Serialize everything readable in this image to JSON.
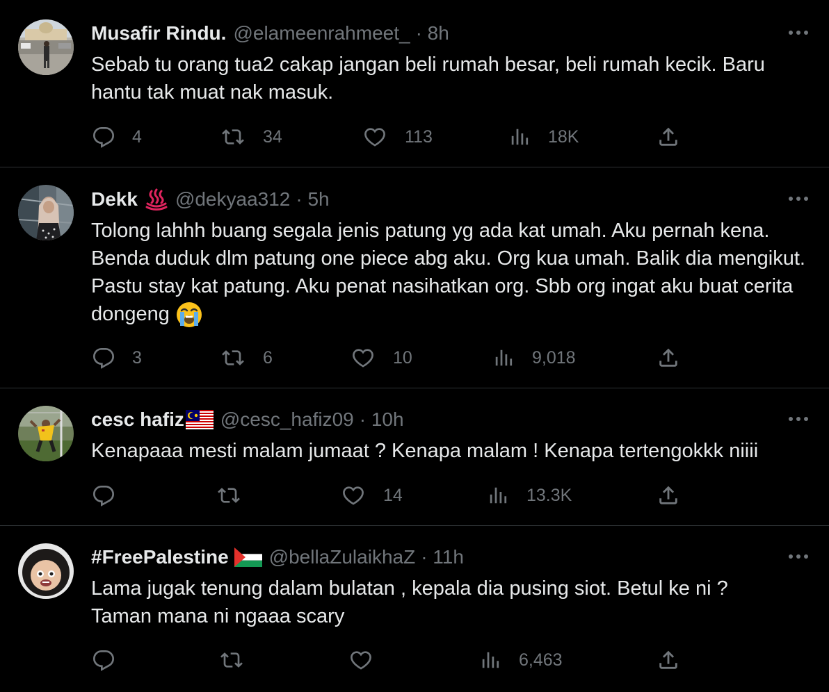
{
  "tweets": [
    {
      "display_name": "Musafir Rindu.",
      "handle": "@elameenrahmeet_",
      "time": "· 8h",
      "text": "Sebab tu orang tua2 cakap jangan beli rumah besar, beli rumah kecik. Baru hantu tak muat nak masuk.",
      "replies": "4",
      "retweets": "34",
      "likes": "113",
      "views": "18K"
    },
    {
      "display_name": "Dekk",
      "name_icon": "hot-springs-emoji",
      "handle": "@dekyaa312",
      "time": "· 5h",
      "text": "Tolong lahhh buang segala jenis patung yg ada kat umah. Aku pernah kena. Benda duduk dlm patung one piece abg aku. Org kua umah. Balik dia mengikut. Pastu stay kat patung. Aku penat nasihatkan org. Sbb org ingat aku buat cerita dongeng",
      "text_emoji": "loudly-crying-face-emoji",
      "replies": "3",
      "retweets": "6",
      "likes": "10",
      "views": "9,018"
    },
    {
      "display_name": "cesc hafiz",
      "name_icon": "malaysia-flag",
      "handle": "@cesc_hafiz09",
      "time": "· 10h",
      "text": "Kenapaaa mesti malam jumaat ? Kenapa malam ! Kenapa tertengokkk niiii",
      "replies": "",
      "retweets": "",
      "likes": "14",
      "views": "13.3K"
    },
    {
      "display_name": "#FreePalestine",
      "name_icon": "palestine-flag",
      "handle": "@bellaZulaikhaZ",
      "time": "· 11h",
      "text": "Lama jugak tenung dalam bulatan , kepala dia pusing siot. Betul ke ni ? Taman mana ni ngaaa scary",
      "replies": "",
      "retweets": "",
      "likes": "",
      "views": "6,463"
    }
  ],
  "colors": {
    "background": "#000000",
    "text": "#e7e9ea",
    "muted": "#71767b",
    "divider": "#2f3336"
  }
}
